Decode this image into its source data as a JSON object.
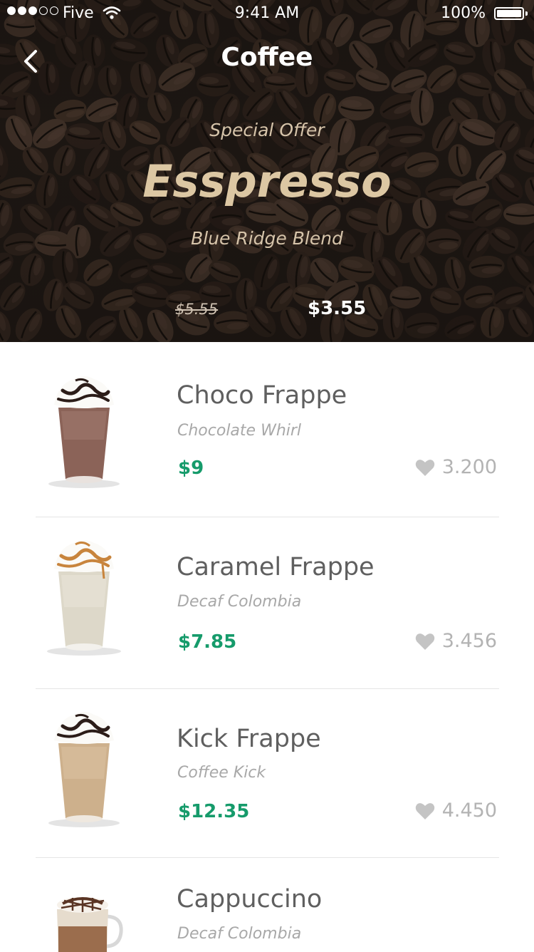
{
  "status_bar": {
    "carrier": "Five",
    "time": "9:41 AM",
    "battery": "100%",
    "signal_bars": 3,
    "signal_total": 5
  },
  "nav": {
    "title": "Coffee",
    "back_icon": "chevron-left-icon"
  },
  "special_offer": {
    "label": "Special Offer",
    "name": "Esspresso",
    "blend": "Blue Ridge Blend",
    "old_price": "$5.55",
    "new_price": "$3.55"
  },
  "products": [
    {
      "name": "Choco Frappe",
      "subtitle": "Chocolate Whirl",
      "price": "$9",
      "likes": "3.200",
      "drink": "chocolate-frappe"
    },
    {
      "name": "Caramel Frappe",
      "subtitle": "Decaf Colombia",
      "price": "$7.85",
      "likes": "3.456",
      "drink": "caramel-frappe"
    },
    {
      "name": "Kick Frappe",
      "subtitle": "Coffee Kick",
      "price": "$12.35",
      "likes": "4.450",
      "drink": "coffee-frappe"
    },
    {
      "name": "Cappuccino",
      "subtitle": "Decaf Colombia",
      "price": "",
      "likes": "",
      "drink": "cappuccino"
    }
  ],
  "colors": {
    "price_green": "#169b6b",
    "offer_gold": "#dcc7a3",
    "title_gray": "#5f5f5f",
    "heart_gray": "#c4c4c4"
  }
}
